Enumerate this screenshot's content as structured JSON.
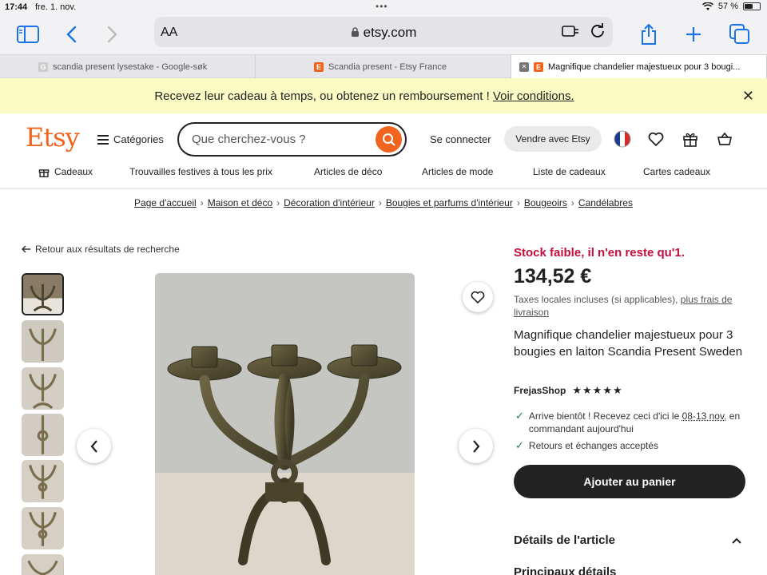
{
  "status": {
    "time": "17:44",
    "date": "fre. 1. nov.",
    "battery": "57 %",
    "battery_level": 0.57
  },
  "browser": {
    "aa": "AA",
    "url": "etsy.com",
    "tabs": [
      {
        "label": "scandia present lysestake - Google-søk",
        "favicon": "G"
      },
      {
        "label": "Scandia present - Etsy France",
        "favicon": "E"
      },
      {
        "label": "Magnifique chandelier majestueux pour 3 bougi...",
        "favicon": "E"
      }
    ]
  },
  "banner": {
    "text": "Recevez leur cadeau à temps, ou obtenez un remboursement ! ",
    "link": "Voir conditions.",
    "close": "✕"
  },
  "header": {
    "logo": "Etsy",
    "categories": "Catégories",
    "search_placeholder": "Que cherchez-vous ?",
    "signin": "Se connecter",
    "sell": "Vendre avec Etsy"
  },
  "nav": [
    "Cadeaux",
    "Trouvailles festives à tous les prix",
    "Articles de déco",
    "Articles de mode",
    "Liste de cadeaux",
    "Cartes cadeaux"
  ],
  "breadcrumb": [
    "Page d'accueil",
    "Maison et déco",
    "Décoration d'intérieur",
    "Bougies et parfums d'intérieur",
    "Bougeoirs",
    "Candélabres"
  ],
  "back_link": "Retour aux résultats de recherche",
  "product": {
    "stock": "Stock faible, il n'en reste qu'1.",
    "price": "134,52 €",
    "tax_text": "Taxes locales incluses (si applicables), ",
    "tax_link": "plus frais de livraison",
    "title": "Magnifique chandelier majestueux pour 3 bougies en laiton Scandia Present Sweden",
    "shop": "FrejasShop",
    "stars": "★★★★★",
    "delivery_pre": "Arrive bientôt ! Recevez ceci d'ici le ",
    "delivery_date": "08-13 nov.",
    "delivery_post": " en commandant aujourd'hui",
    "returns": "Retours et échanges acceptés",
    "add_to_cart": "Ajouter au panier",
    "details": "Détails de l'article",
    "principaux": "Principaux détails"
  },
  "colors": {
    "etsy_orange": "#f1641e",
    "stock_red": "#c40d3c",
    "banner_yellow": "#fbfbc4"
  }
}
